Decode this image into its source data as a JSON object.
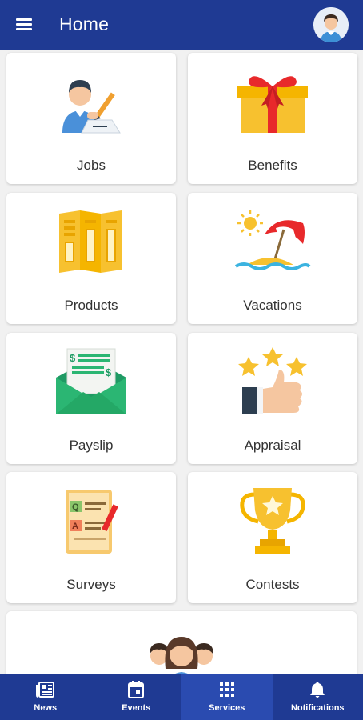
{
  "header": {
    "title": "Home",
    "menu_icon": "menu-icon",
    "avatar_icon": "user-avatar-icon"
  },
  "tiles": [
    {
      "label": "Jobs",
      "icon": "job-application-icon"
    },
    {
      "label": "Benefits",
      "icon": "gift-icon"
    },
    {
      "label": "Products",
      "icon": "brochure-icon"
    },
    {
      "label": "Vacations",
      "icon": "beach-umbrella-icon"
    },
    {
      "label": "Payslip",
      "icon": "payslip-envelope-icon"
    },
    {
      "label": "Appraisal",
      "icon": "thumbs-up-stars-icon"
    },
    {
      "label": "Surveys",
      "icon": "survey-qa-icon"
    },
    {
      "label": "Contests",
      "icon": "trophy-icon"
    },
    {
      "label": "",
      "icon": "people-group-icon"
    }
  ],
  "bottom_nav": {
    "items": [
      {
        "label": "News",
        "icon": "newspaper-icon"
      },
      {
        "label": "Events",
        "icon": "calendar-icon"
      },
      {
        "label": "Services",
        "icon": "grid-icon"
      },
      {
        "label": "Notifications",
        "icon": "bell-icon"
      }
    ],
    "active": "Services"
  },
  "colors": {
    "primary": "#1f3a93",
    "active_tab": "#2a4bb0",
    "background": "#f1f1f1"
  }
}
